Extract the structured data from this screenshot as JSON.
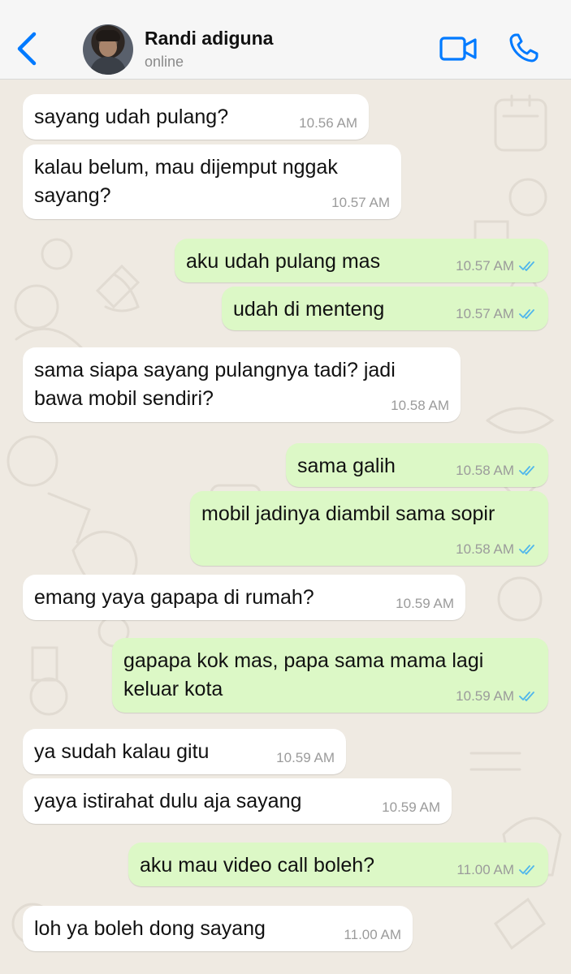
{
  "header": {
    "contact_name": "Randi adiguna",
    "status": "online",
    "back_icon": "chevron-left-icon",
    "video_icon": "video-call-icon",
    "call_icon": "phone-icon",
    "accent_color": "#007aff"
  },
  "colors": {
    "incoming_bubble": "#ffffff",
    "outgoing_bubble": "#dcf8c6",
    "read_ticks": "#4fb6ec",
    "wallpaper": "#efeae2"
  },
  "messages": [
    {
      "direction": "in",
      "text": "sayang udah pulang?",
      "time": "10.56 AM"
    },
    {
      "direction": "in",
      "text": "kalau belum, mau dijemput nggak sayang?",
      "time": "10.57 AM"
    },
    {
      "direction": "out",
      "text": "aku udah pulang mas",
      "time": "10.57 AM",
      "read": true
    },
    {
      "direction": "out",
      "text": "udah di menteng",
      "time": "10.57 AM",
      "read": true
    },
    {
      "direction": "in",
      "text": "sama siapa sayang pulangnya tadi? jadi bawa mobil sendiri?",
      "time": "10.58 AM"
    },
    {
      "direction": "out",
      "text": "sama galih",
      "time": "10.58 AM",
      "read": true
    },
    {
      "direction": "out",
      "text": "mobil jadinya diambil sama sopir",
      "time": "10.58 AM",
      "read": true
    },
    {
      "direction": "in",
      "text": "emang yaya gapapa di rumah?",
      "time": "10.59 AM"
    },
    {
      "direction": "out",
      "text": "gapapa kok mas, papa sama mama lagi keluar kota",
      "time": "10.59 AM",
      "read": true
    },
    {
      "direction": "in",
      "text": "ya sudah kalau gitu",
      "time": "10.59 AM"
    },
    {
      "direction": "in",
      "text": "yaya istirahat dulu aja sayang",
      "time": "10.59 AM"
    },
    {
      "direction": "out",
      "text": "aku mau video call boleh?",
      "time": "11.00 AM",
      "read": true
    },
    {
      "direction": "in",
      "text": "loh ya boleh dong sayang",
      "time": "11.00 AM"
    }
  ]
}
